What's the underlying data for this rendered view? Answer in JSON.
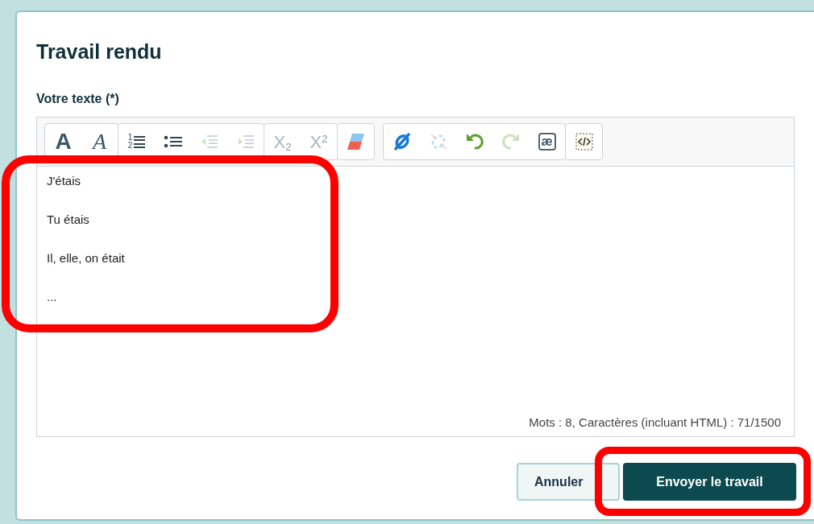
{
  "dialog": {
    "title": "Travail rendu",
    "field_label": "Votre texte (*)"
  },
  "toolbar": {
    "groups": [
      {
        "items": [
          {
            "kind": "bold",
            "glyph": "A",
            "disabled": false
          },
          {
            "kind": "italic",
            "glyph": "A",
            "disabled": false
          }
        ]
      },
      {
        "items": [
          {
            "kind": "numbered-list",
            "markers": [
              "1",
              "2"
            ],
            "disabled": false
          },
          {
            "kind": "bullet-list",
            "disabled": false
          },
          {
            "kind": "outdent",
            "disabled": true
          },
          {
            "kind": "indent",
            "disabled": true
          }
        ]
      },
      {
        "items": [
          {
            "kind": "subscript",
            "glyph": "X",
            "index": "2",
            "disabled": true
          },
          {
            "kind": "superscript",
            "glyph": "X",
            "index": "2",
            "disabled": true
          }
        ]
      },
      {
        "items": [
          {
            "kind": "eraser",
            "disabled": false
          }
        ]
      },
      {
        "items": [
          {
            "kind": "link",
            "disabled": false
          },
          {
            "kind": "unlink",
            "disabled": true
          },
          {
            "kind": "undo",
            "disabled": false
          },
          {
            "kind": "redo",
            "disabled": true
          },
          {
            "kind": "special-char",
            "glyph": "æ",
            "disabled": false
          }
        ]
      },
      {
        "items": [
          {
            "kind": "source",
            "disabled": false
          }
        ]
      }
    ]
  },
  "editor": {
    "lines": [
      "J'étais",
      "Tu étais",
      "Il, elle, on était",
      "..."
    ],
    "highlighted": true,
    "counter": "Mots : 8, Caractères (incluant HTML) : 71/1500"
  },
  "buttons": [
    {
      "label": "Annuler",
      "kind": "secondary"
    },
    {
      "label": "Envoyer le travail",
      "kind": "primary",
      "highlighted": true
    }
  ]
}
